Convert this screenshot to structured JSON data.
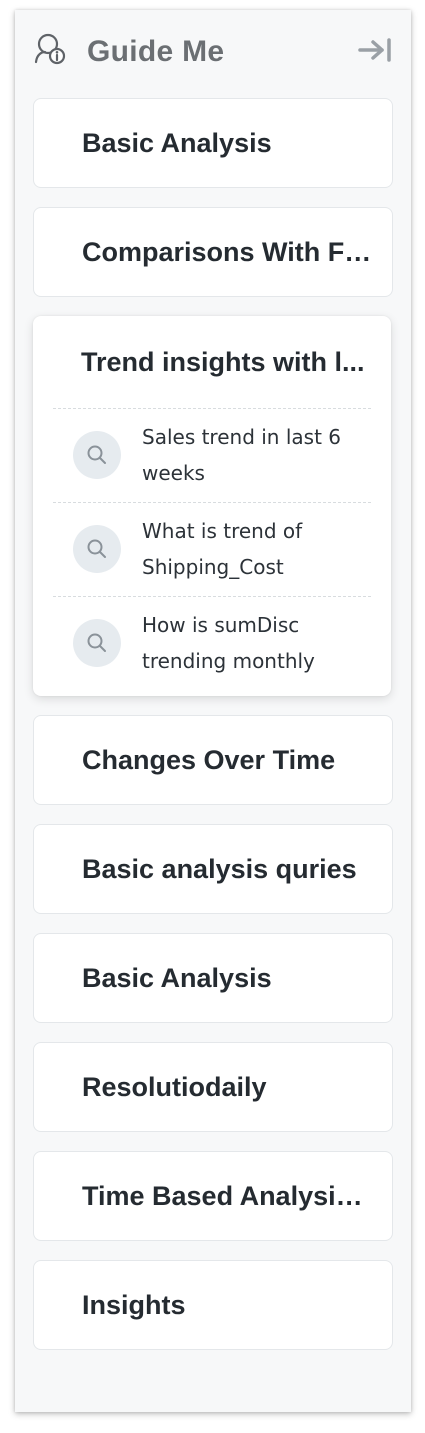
{
  "panel": {
    "title": "Guide Me",
    "icons": {
      "guide": "guide-person-info-icon",
      "collapse": "collapse-panel-arrow-icon"
    }
  },
  "cards": [
    {
      "title": "Basic Analysis"
    },
    {
      "title": "Comparisons With Fi..."
    },
    {
      "title": "Trend insights with l...",
      "expanded": true,
      "suggestions": [
        {
          "text": "Sales trend in last 6 weeks",
          "icon": "search-icon"
        },
        {
          "text": "What is trend of Shipping_Cost",
          "icon": "search-icon"
        },
        {
          "text": "How is sumDisc trending monthly",
          "icon": "search-icon"
        }
      ]
    },
    {
      "title": "Changes Over Time"
    },
    {
      "title": "Basic analysis quries"
    },
    {
      "title": "Basic Analysis"
    },
    {
      "title": "Resolutiodaily"
    },
    {
      "title": "Time Based Analysis ..."
    },
    {
      "title": "Insights"
    }
  ],
  "colors": {
    "panel_bg": "#f7f8f9",
    "card_bg": "#ffffff",
    "title_text": "#252b31",
    "muted_text": "#6b6f73",
    "icon_bg": "#e6ebef"
  }
}
